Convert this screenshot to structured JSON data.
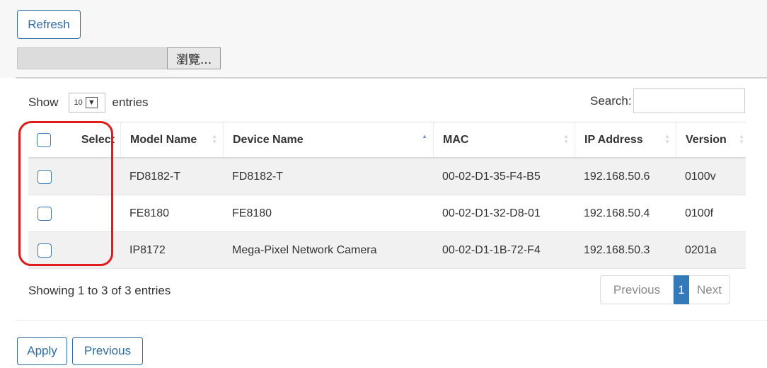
{
  "toolbar": {
    "refresh_label": "Refresh",
    "browse_label": "瀏覽..."
  },
  "table_controls": {
    "show_label": "Show",
    "entries_value": "10",
    "entries_label": "entries",
    "search_label": "Search:",
    "search_value": ""
  },
  "table": {
    "headers": {
      "select": "Select",
      "model_name": "Model Name",
      "device_name": "Device Name",
      "mac": "MAC",
      "ip_address": "IP Address",
      "version": "Version"
    },
    "sorted_column": "device_name",
    "sort_direction": "ascending",
    "rows": [
      {
        "model_name": "FD8182-T",
        "device_name": "FD8182-T",
        "mac": "00-02-D1-35-F4-B5",
        "ip_address": "192.168.50.6",
        "version": "0100v",
        "selected": false
      },
      {
        "model_name": "FE8180",
        "device_name": "FE8180",
        "mac": "00-02-D1-32-D8-01",
        "ip_address": "192.168.50.4",
        "version": "0100f",
        "selected": false
      },
      {
        "model_name": "IP8172",
        "device_name": "Mega-Pixel Network Camera",
        "mac": "00-02-D1-1B-72-F4",
        "ip_address": "192.168.50.3",
        "version": "0201a",
        "selected": false
      }
    ]
  },
  "footer": {
    "info": "Showing 1 to 3 of 3 entries",
    "pagination": {
      "previous": "Previous",
      "current": "1",
      "next": "Next"
    }
  },
  "actions": {
    "apply_label": "Apply",
    "previous_label": "Previous"
  },
  "colors": {
    "accent": "#337ab7",
    "highlight": "#e01b1b",
    "row_stripe": "#f1f1f1"
  }
}
